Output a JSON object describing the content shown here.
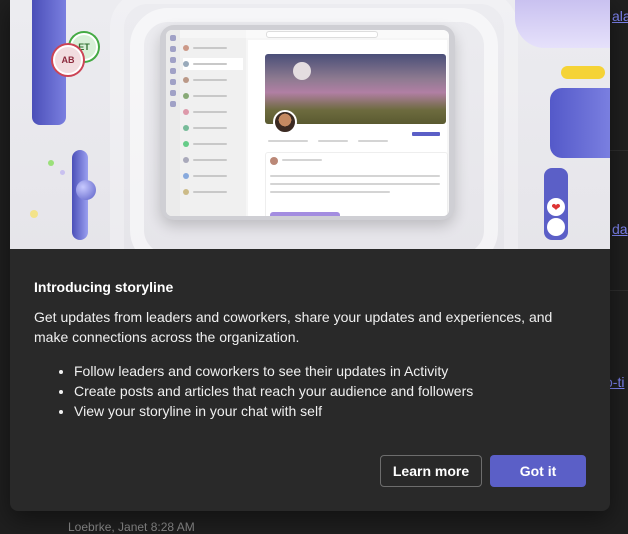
{
  "background": {
    "links": [
      "ala",
      "da",
      "o-ti"
    ],
    "footer_text": "Loebrke, Janet  8:28 AM"
  },
  "hero": {
    "stickers": {
      "ab": "AB",
      "et": "ET"
    },
    "reactions": [
      "❤",
      "😄"
    ]
  },
  "dialog": {
    "title": "Introducing storyline",
    "description": "Get updates from leaders and coworkers, share your updates and experiences, and make connections across the organization.",
    "bullets": [
      "Follow leaders and coworkers to see their updates in Activity",
      "Create posts and articles that reach your audience and followers",
      "View your storyline in your chat with self"
    ],
    "buttons": {
      "learn_more": "Learn more",
      "got_it": "Got it"
    }
  },
  "colors": {
    "primary": "#5b5fc7",
    "dialog_bg": "#292929",
    "page_bg": "#1f1f1f"
  }
}
